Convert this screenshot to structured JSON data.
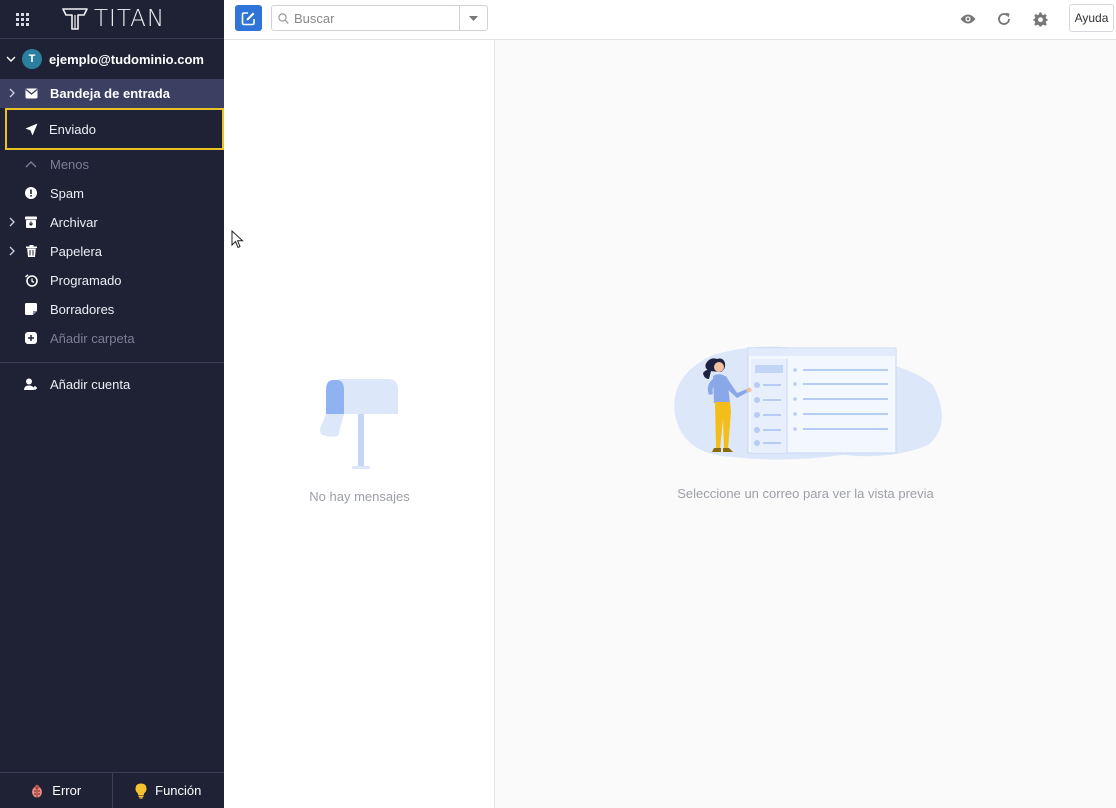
{
  "app": {
    "name": "TITAN"
  },
  "account": {
    "initial": "T",
    "email": "ejemplo@tudominio.com"
  },
  "folders": [
    {
      "label": "Bandeja de entrada",
      "icon": "envelope-icon"
    },
    {
      "label": "Enviado",
      "icon": "send-icon"
    },
    {
      "label": "Menos",
      "icon": "chevron-up-icon"
    },
    {
      "label": "Spam",
      "icon": "alert-icon"
    },
    {
      "label": "Archivar",
      "icon": "archive-icon"
    },
    {
      "label": "Papelera",
      "icon": "trash-icon"
    },
    {
      "label": "Programado",
      "icon": "clock-icon"
    },
    {
      "label": "Borradores",
      "icon": "draft-icon"
    },
    {
      "label": "Añadir carpeta",
      "icon": "plus-icon"
    }
  ],
  "add_account": {
    "label": "Añadir cuenta"
  },
  "bottom": {
    "error_label": "Error",
    "feature_label": "Función"
  },
  "toolbar": {
    "search_placeholder": "Buscar",
    "help_label": "Ayuda"
  },
  "message_list": {
    "empty_text": "No hay mensajes"
  },
  "preview": {
    "empty_text": "Seleccione un correo para ver la vista previa"
  },
  "colors": {
    "sidebar_bg": "#1f2235",
    "accent": "#2f74d9",
    "highlight": "#e8c227",
    "active_bg": "#3b3f62"
  }
}
